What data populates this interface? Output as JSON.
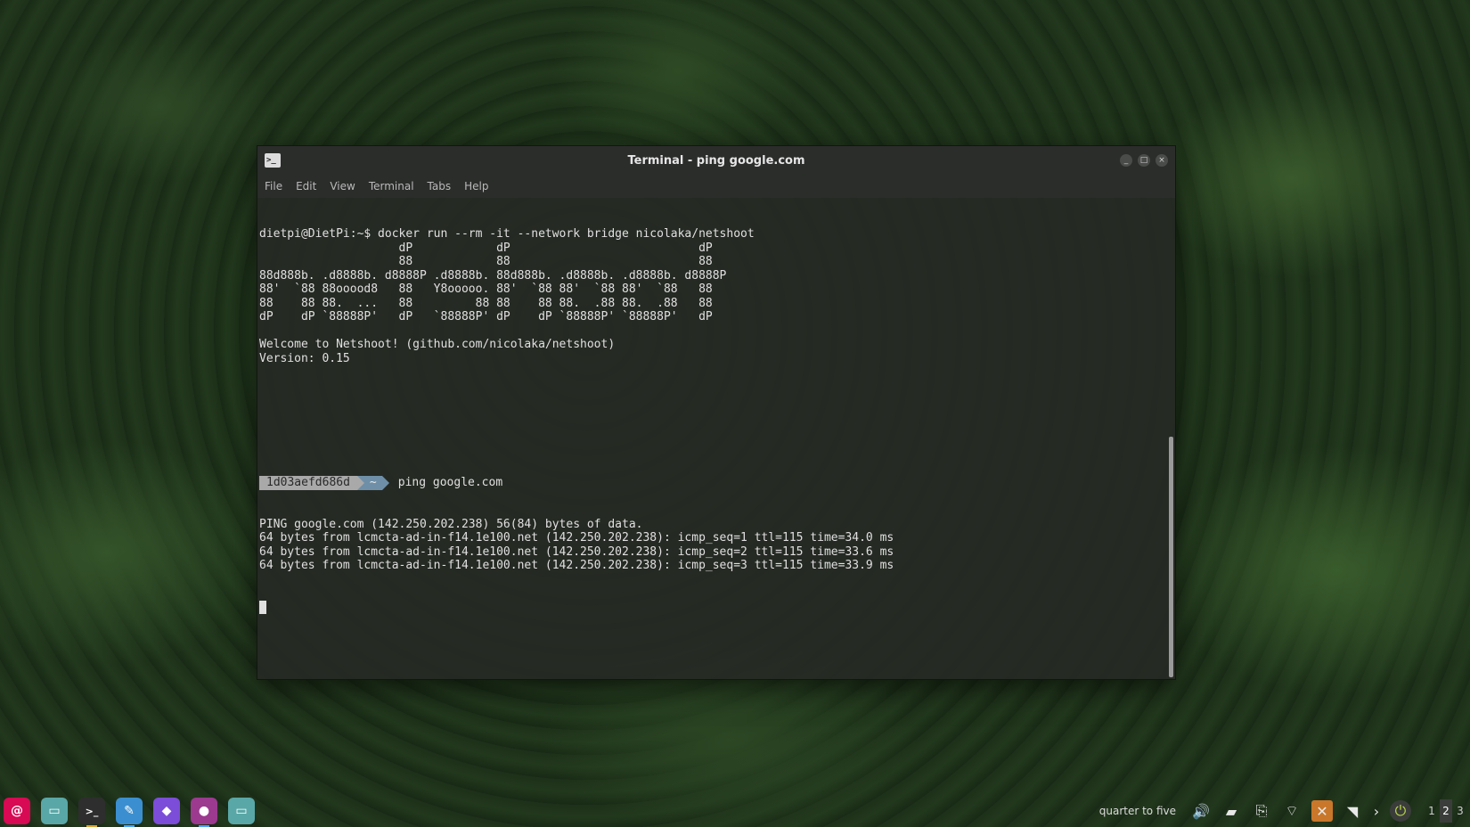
{
  "window": {
    "title": "Terminal - ping google.com",
    "icon": "terminal-icon",
    "controls": [
      "_",
      "□",
      "×"
    ]
  },
  "menu": [
    "File",
    "Edit",
    "View",
    "Terminal",
    "Tabs",
    "Help"
  ],
  "terminal": {
    "lines": [
      "dietpi@DietPi:~$ docker run --rm -it --network bridge nicolaka/netshoot",
      "                    dP            dP                           dP",
      "                    88            88                           88",
      "88d888b. .d8888b. d8888P .d8888b. 88d888b. .d8888b. .d8888b. d8888P",
      "88'  `88 88ooood8   88   Y8ooooo. 88'  `88 88'  `88 88'  `88   88",
      "88    88 88.  ...   88         88 88    88 88.  .88 88.  .88   88",
      "dP    dP `88888P'   dP   `88888P' dP    dP `88888P' `88888P'   dP",
      "",
      "Welcome to Netshoot! (github.com/nicolaka/netshoot)",
      "Version: 0.15",
      "",
      "",
      "",
      "",
      "",
      ""
    ],
    "prompt": {
      "host": "1d03aefd686d",
      "dir": "~",
      "command": "ping google.com"
    },
    "output": [
      "PING google.com (142.250.202.238) 56(84) bytes of data.",
      "64 bytes from lcmcta-ad-in-f14.1e100.net (142.250.202.238): icmp_seq=1 ttl=115 time=34.0 ms",
      "64 bytes from lcmcta-ad-in-f14.1e100.net (142.250.202.238): icmp_seq=2 ttl=115 time=33.6 ms",
      "64 bytes from lcmcta-ad-in-f14.1e100.net (142.250.202.238): icmp_seq=3 ttl=115 time=33.9 ms"
    ]
  },
  "taskbar": {
    "launchers": [
      {
        "name": "debian-menu-icon",
        "color": "#d70a53",
        "glyph": "@"
      },
      {
        "name": "file-manager-icon",
        "color": "#5aa7a7",
        "glyph": "▭"
      },
      {
        "name": "terminal-icon",
        "color": "#2e2e2e",
        "glyph": ">_"
      },
      {
        "name": "text-editor-icon",
        "color": "#3b8fd0",
        "glyph": "✎"
      },
      {
        "name": "obsidian-icon",
        "color": "#7c4dd8",
        "glyph": "◆"
      },
      {
        "name": "firefox-icon",
        "color": "#9b3a8f",
        "glyph": "●"
      },
      {
        "name": "folder-icon",
        "color": "#5aa7a7",
        "glyph": "▭"
      }
    ],
    "clock": "quarter to five",
    "tray": [
      {
        "name": "volume-icon",
        "glyph": "🔊"
      },
      {
        "name": "notes-icon",
        "glyph": "▰"
      },
      {
        "name": "clipboard-icon",
        "glyph": "⎘"
      },
      {
        "name": "network-icon",
        "glyph": "⌔"
      },
      {
        "name": "app-tray-icon",
        "glyph": "✕"
      },
      {
        "name": "wifi-icon",
        "glyph": "◥"
      },
      {
        "name": "expand-icon",
        "glyph": "›"
      },
      {
        "name": "logout-icon",
        "glyph": "⏻"
      }
    ],
    "workspaces": [
      "1",
      "2",
      "3"
    ],
    "active_workspace": "2"
  }
}
